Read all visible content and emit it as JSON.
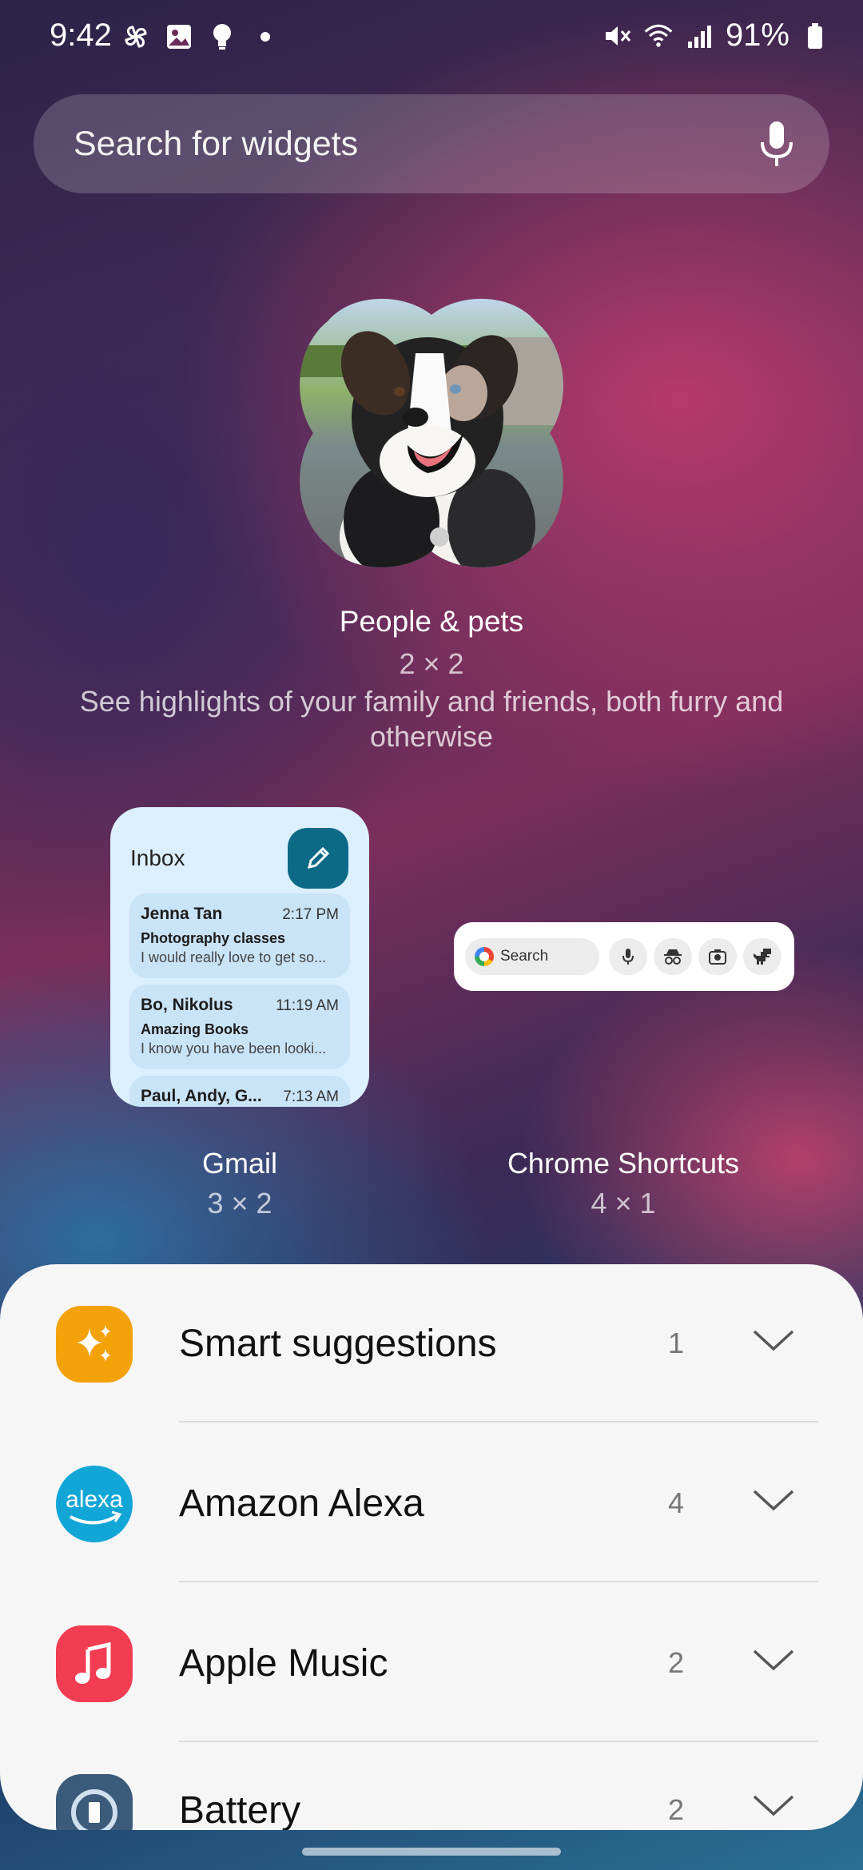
{
  "status_bar": {
    "time": "9:42",
    "battery": "91%",
    "left_icons": [
      "pinwheel-icon",
      "gallery-icon",
      "bulb-icon",
      "dot-icon"
    ],
    "right_icons": [
      "mute-icon",
      "wifi-icon",
      "signal-icon",
      "battery-icon"
    ]
  },
  "search": {
    "placeholder": "Search for widgets",
    "icon": "mic-icon"
  },
  "featured": {
    "title": "People & pets",
    "size": "2 × 2",
    "description": "See highlights of your family and friends, both furry and otherwise"
  },
  "gmail_widget": {
    "header": "Inbox",
    "emails": [
      {
        "from": "Jenna Tan",
        "time": "2:17 PM",
        "subject": "Photography classes",
        "snippet": "I would really love to get so..."
      },
      {
        "from": "Bo, Nikolus",
        "time": "11:19 AM",
        "subject": "Amazing Books",
        "snippet": "I know you have been looki..."
      },
      {
        "from": "Paul, Andy, G...",
        "time": "7:13 AM",
        "subject": "",
        "snippet": ""
      }
    ],
    "label": "Gmail",
    "size": "3 × 2"
  },
  "chrome_widget": {
    "search": "Search",
    "buttons": [
      "mic-icon",
      "incognito-icon",
      "lens-icon",
      "dino-icon"
    ],
    "label": "Chrome Shortcuts",
    "size": "4 × 1"
  },
  "apps": [
    {
      "name": "Smart suggestions",
      "count": "1",
      "icon": "sparkle-icon",
      "color": "#f4a20a"
    },
    {
      "name": "Amazon Alexa",
      "count": "4",
      "icon": "alexa-icon",
      "color": "#12a6d6",
      "icon_text": "alexa"
    },
    {
      "name": "Apple Music",
      "count": "2",
      "icon": "music-note-icon",
      "color": "#f23c52"
    },
    {
      "name": "Battery",
      "count": "2",
      "icon": "battery-app-icon",
      "color": "#3c5a7a"
    }
  ]
}
